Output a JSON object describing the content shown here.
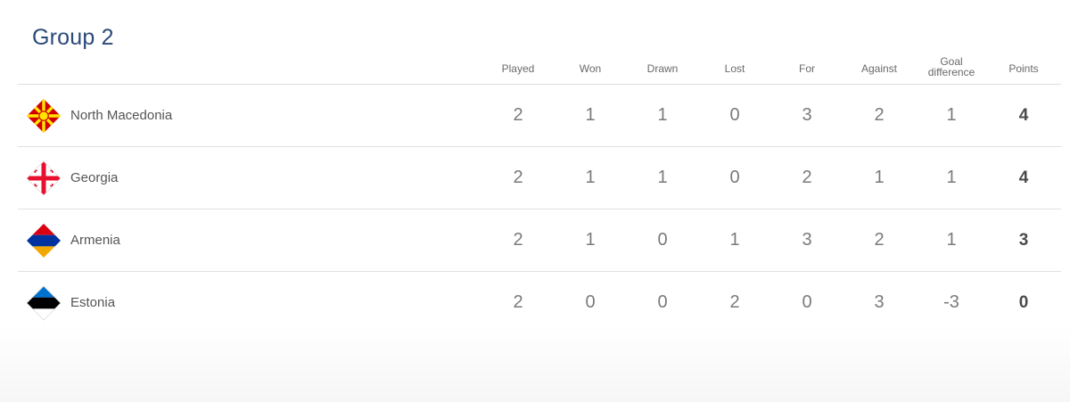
{
  "group": {
    "title": "Group 2"
  },
  "columns": {
    "played": "Played",
    "won": "Won",
    "drawn": "Drawn",
    "lost": "Lost",
    "for": "For",
    "against": "Against",
    "goal_difference_line1": "Goal",
    "goal_difference_line2": "difference",
    "points": "Points"
  },
  "teams": [
    {
      "name": "North Macedonia",
      "flag_icon": "north-macedonia-flag-icon",
      "played": "2",
      "won": "1",
      "drawn": "1",
      "lost": "0",
      "for": "3",
      "against": "2",
      "goal_difference": "1",
      "points": "4"
    },
    {
      "name": "Georgia",
      "flag_icon": "georgia-flag-icon",
      "played": "2",
      "won": "1",
      "drawn": "1",
      "lost": "0",
      "for": "2",
      "against": "1",
      "goal_difference": "1",
      "points": "4"
    },
    {
      "name": "Armenia",
      "flag_icon": "armenia-flag-icon",
      "played": "2",
      "won": "1",
      "drawn": "0",
      "lost": "1",
      "for": "3",
      "against": "2",
      "goal_difference": "1",
      "points": "3"
    },
    {
      "name": "Estonia",
      "flag_icon": "estonia-flag-icon",
      "played": "2",
      "won": "0",
      "drawn": "0",
      "lost": "2",
      "for": "0",
      "against": "3",
      "goal_difference": "-3",
      "points": "0"
    }
  ],
  "colors": {
    "title": "#2b4a78",
    "divider": "#dcdcdc",
    "north_macedonia_red": "#d20000",
    "north_macedonia_yellow": "#ffe600",
    "georgia_red": "#e8112d",
    "armenia_red": "#d90012",
    "armenia_blue": "#0033a0",
    "armenia_orange": "#f2a800",
    "estonia_blue": "#0072ce",
    "estonia_black": "#000000"
  }
}
